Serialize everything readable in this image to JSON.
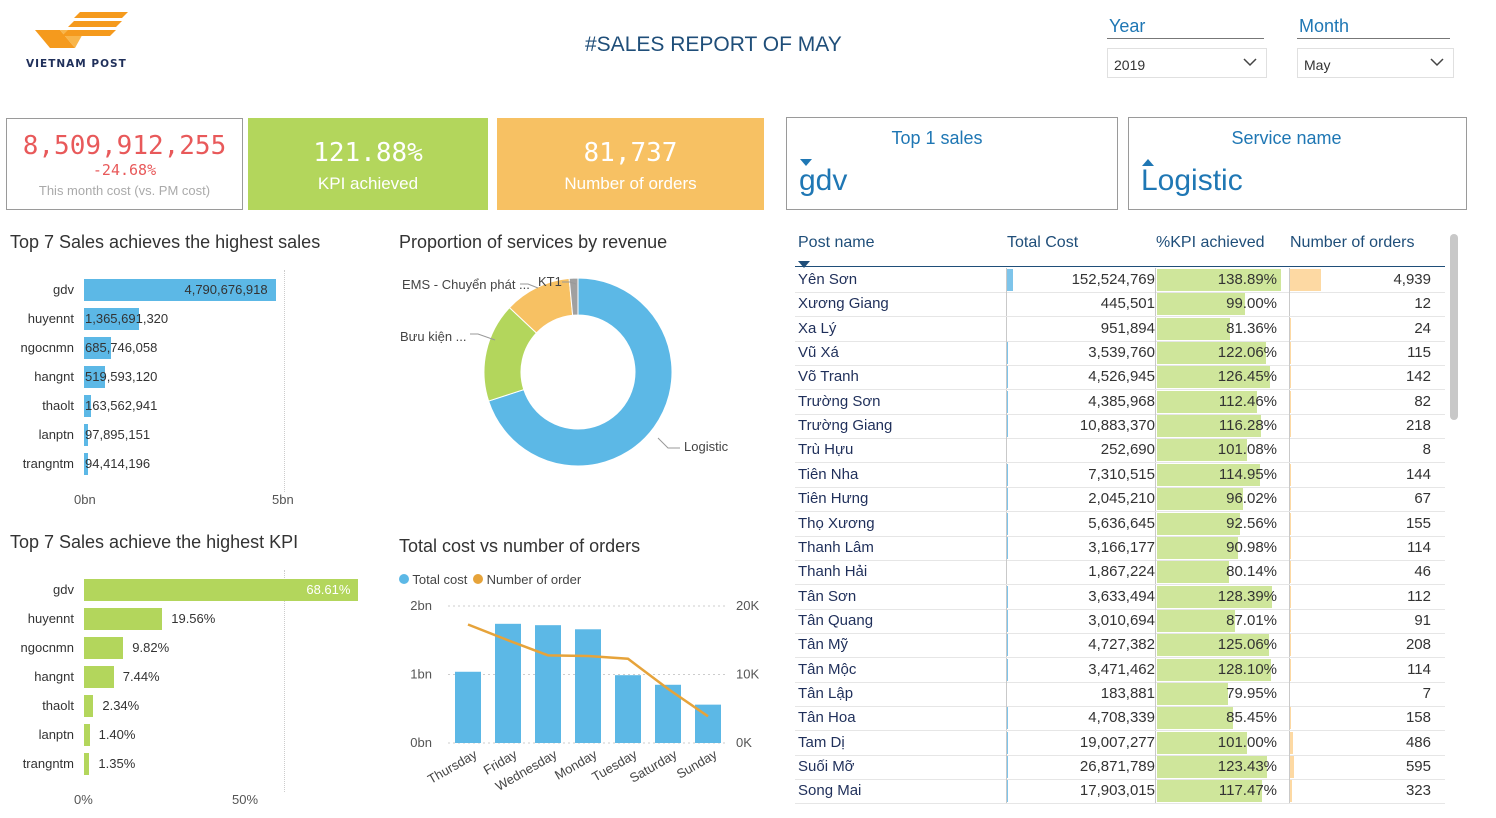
{
  "brand": {
    "logo_text": "VIETNAM POST"
  },
  "title": "#SALES REPORT OF MAY",
  "filters": {
    "year": {
      "label": "Year",
      "value": "2019"
    },
    "month": {
      "label": "Month",
      "value": "May"
    }
  },
  "cards": {
    "cost": {
      "value": "8,509,912,255",
      "delta": "-24.68%",
      "caption": "This month cost (vs. PM cost)"
    },
    "kpi": {
      "value": "121.88%",
      "caption": "KPI achieved"
    },
    "orders": {
      "value": "81,737",
      "caption": "Number of orders"
    },
    "top_sales": {
      "label": "Top 1 sales",
      "value": "gdv"
    },
    "service": {
      "label": "Service name",
      "value": "Logistic"
    }
  },
  "colors": {
    "blue": "#5cb8e6",
    "green": "#b3d65c",
    "orange": "#f7c163",
    "red": "#e8595a",
    "dark_blue": "#1f4e79"
  },
  "sales_chart": {
    "title": "Top 7 Sales achieves the highest sales",
    "axis": [
      "0bn",
      "5bn"
    ],
    "chart_data": {
      "type": "bar",
      "categories": [
        "gdv",
        "huyennt",
        "ngocnmn",
        "hangnt",
        "thaolt",
        "lanptn",
        "trangntm"
      ],
      "values": [
        4790676918,
        1365691320,
        685746058,
        519593120,
        163562941,
        97895151,
        94414196
      ],
      "labels": [
        "4,790,676,918",
        "1,365,691,320",
        "685,746,058",
        "519,593,120",
        "163,562,941",
        "97,895,151",
        "94,414,196"
      ],
      "xlim": [
        0,
        5000000000
      ]
    }
  },
  "kpi_chart": {
    "title": "Top 7 Sales achieve the highest KPI",
    "axis": [
      "0%",
      "50%"
    ],
    "chart_data": {
      "type": "bar",
      "categories": [
        "gdv",
        "huyennt",
        "ngocnmn",
        "hangnt",
        "thaolt",
        "lanptn",
        "trangntm"
      ],
      "values": [
        68.61,
        19.56,
        9.82,
        7.44,
        2.34,
        1.4,
        1.35
      ],
      "labels": [
        "68.61%",
        "19.56%",
        "9.82%",
        "7.44%",
        "2.34%",
        "1.40%",
        "1.35%"
      ],
      "xlim": [
        0,
        50
      ]
    }
  },
  "donut": {
    "title": "Proportion of services by revenue",
    "chart_data": {
      "type": "pie",
      "categories": [
        "Logistic",
        "Bưu kiện ...",
        "EMS - Chuyển phát ...",
        "KT1"
      ],
      "values": [
        70,
        17,
        11.5,
        1.5
      ]
    }
  },
  "combo": {
    "title": "Total cost vs number of orders",
    "legend": [
      "Total cost",
      "Number of order"
    ],
    "left_axis": [
      "2bn",
      "1bn",
      "0bn"
    ],
    "right_axis": [
      "20K",
      "10K",
      "0K"
    ],
    "chart_data": {
      "type": "bar",
      "categories": [
        "Thursday",
        "Friday",
        "Wednesday",
        "Monday",
        "Tuesday",
        "Saturday",
        "Sunday"
      ],
      "series": [
        {
          "name": "Total cost",
          "values": [
            1.04,
            1.74,
            1.72,
            1.66,
            0.99,
            0.85,
            0.56
          ]
        },
        {
          "name": "Number of order",
          "values": [
            17300,
            15000,
            12800,
            12700,
            12300,
            7900,
            3900
          ]
        }
      ],
      "ylim_left": [
        0,
        2
      ],
      "ylim_right": [
        0,
        20000
      ]
    }
  },
  "table": {
    "headers": [
      "Post name",
      "Total Cost",
      "%KPI achieved",
      "Number of orders"
    ],
    "rows": [
      [
        "Yên Sơn",
        "152,524,769",
        "138.89%",
        "4,939"
      ],
      [
        "Xương Giang",
        "445,501",
        "99.00%",
        "12"
      ],
      [
        "Xa Lý",
        "951,894",
        "81.36%",
        "24"
      ],
      [
        "Vũ Xá",
        "3,539,760",
        "122.06%",
        "115"
      ],
      [
        "Võ Tranh",
        "4,526,945",
        "126.45%",
        "142"
      ],
      [
        "Trường Sơn",
        "4,385,968",
        "112.46%",
        "82"
      ],
      [
        "Trường Giang",
        "10,883,370",
        "116.28%",
        "218"
      ],
      [
        "Trù Hựu",
        "252,690",
        "101.08%",
        "8"
      ],
      [
        "Tiên Nha",
        "7,310,515",
        "114.95%",
        "144"
      ],
      [
        "Tiên Hưng",
        "2,045,210",
        "96.02%",
        "67"
      ],
      [
        "Thọ Xương",
        "5,636,645",
        "92.56%",
        "155"
      ],
      [
        "Thanh Lâm",
        "3,166,177",
        "90.98%",
        "114"
      ],
      [
        "Thanh Hải",
        "1,867,224",
        "80.14%",
        "46"
      ],
      [
        "Tân Sơn",
        "3,633,494",
        "128.39%",
        "112"
      ],
      [
        "Tân Quang",
        "3,010,694",
        "87.01%",
        "91"
      ],
      [
        "Tân Mỹ",
        "4,727,382",
        "125.06%",
        "208"
      ],
      [
        "Tân Mộc",
        "3,471,462",
        "128.10%",
        "114"
      ],
      [
        "Tân Lập",
        "183,881",
        "79.95%",
        "7"
      ],
      [
        "Tân Hoa",
        "4,708,339",
        "85.45%",
        "158"
      ],
      [
        "Tam Dị",
        "19,007,277",
        "101.00%",
        "486"
      ],
      [
        "Suối Mỡ",
        "26,871,789",
        "123.43%",
        "595"
      ],
      [
        "Song Mai",
        "17,903,015",
        "117.47%",
        "323"
      ]
    ]
  }
}
